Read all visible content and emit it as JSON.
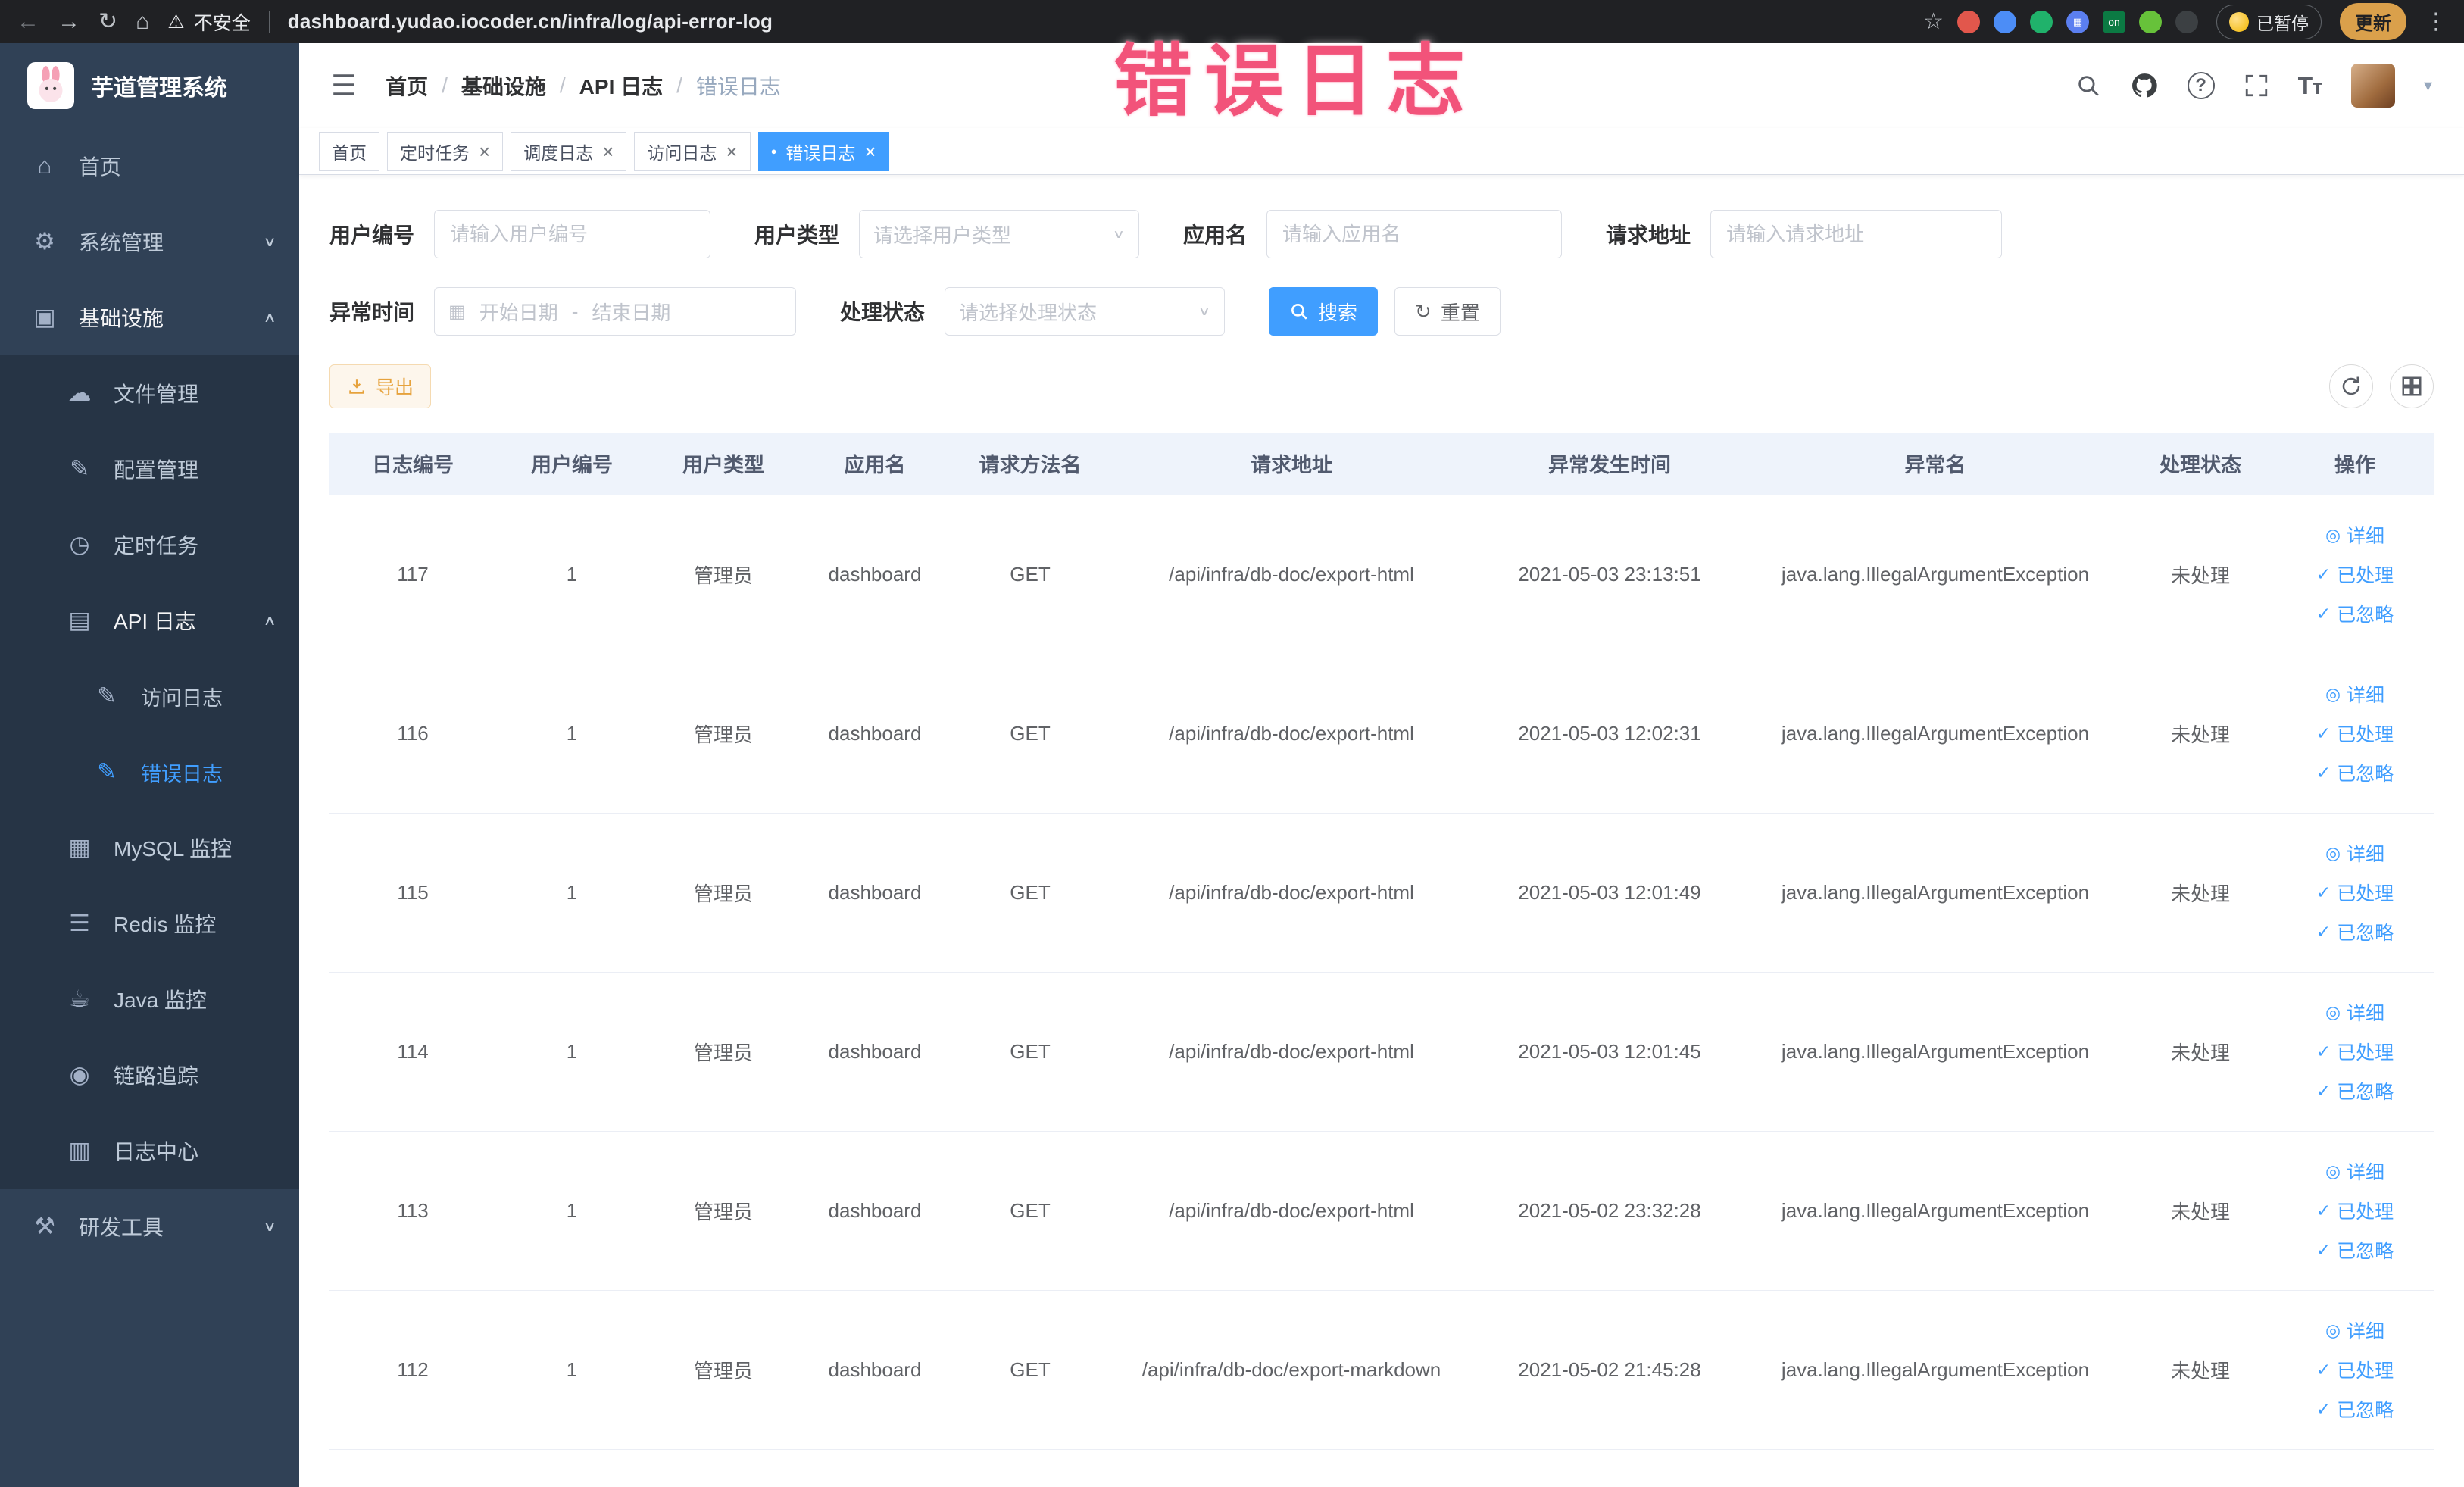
{
  "colors": {
    "primary": "#409eff",
    "warning": "#e6a23c",
    "annotation_pink": "#f2537a",
    "sidebar_bg": "#304156",
    "submenu_bg": "#263445"
  },
  "annotation": {
    "text": "错误日志"
  },
  "browser": {
    "security_label": "不安全",
    "url": "dashboard.yudao.iocoder.cn/infra/log/api-error-log",
    "paused_badge": "已暂停",
    "update_button": "更新"
  },
  "icons": {
    "back": "←",
    "forward": "→",
    "reload": "↻",
    "chrome_home": "⌂",
    "warning": "⚠",
    "star": "☆",
    "menu_dots": "⋮",
    "hamburger": "☰",
    "caret_down": "▾",
    "chevron_down": "∨",
    "chevron_up": "∧",
    "close": "×",
    "dot": "●",
    "check": "✓",
    "eye": "◎",
    "calendar": "▦",
    "separator": "/",
    "home": "⌂",
    "system": "⚙",
    "infra": "▣",
    "file": "☁",
    "config": "✎",
    "job": "◷",
    "api_log": "▤",
    "access_log": "✎",
    "error_log": "✎",
    "mysql": "▦",
    "redis": "☰",
    "java": "☕",
    "tracing": "◉",
    "log_center": "▥",
    "dev_tools": "⚒",
    "grid_glyph": "▦",
    "on_badge": "on"
  },
  "sidebar": {
    "logo_title": "芋道管理系统",
    "menu": {
      "home": "首页",
      "system": "系统管理",
      "infra": "基础设施",
      "dev_tools": "研发工具",
      "infra_children": {
        "file": "文件管理",
        "config": "配置管理",
        "job": "定时任务",
        "api_log": "API 日志",
        "api_access_log": "访问日志",
        "api_error_log": "错误日志",
        "mysql": "MySQL 监控",
        "redis": "Redis 监控",
        "java": "Java 监控",
        "tracing": "链路追踪",
        "log_center": "日志中心"
      }
    }
  },
  "header": {
    "breadcrumb": [
      "首页",
      "基础设施",
      "API 日志",
      "错误日志"
    ]
  },
  "tags": {
    "home": "首页",
    "job": "定时任务",
    "job_log": "调度日志",
    "access_log": "访问日志",
    "error_log": "错误日志"
  },
  "filters": {
    "user_id": {
      "label": "用户编号",
      "placeholder": "请输入用户编号"
    },
    "user_type": {
      "label": "用户类型",
      "placeholder": "请选择用户类型"
    },
    "app_name": {
      "label": "应用名",
      "placeholder": "请输入应用名"
    },
    "request_url": {
      "label": "请求地址",
      "placeholder": "请输入请求地址"
    },
    "exception_time": {
      "label": "异常时间",
      "start_placeholder": "开始日期",
      "separator": "-",
      "end_placeholder": "结束日期"
    },
    "process_status": {
      "label": "处理状态",
      "placeholder": "请选择处理状态"
    },
    "search_button": "搜索",
    "reset_button": "重置"
  },
  "toolbar": {
    "export_label": "导出"
  },
  "table": {
    "columns": [
      "日志编号",
      "用户编号",
      "用户类型",
      "应用名",
      "请求方法名",
      "请求地址",
      "异常发生时间",
      "异常名",
      "处理状态",
      "操作"
    ],
    "actions": {
      "detail": "详细",
      "process": "已处理",
      "ignore": "已忽略"
    },
    "rows": [
      {
        "id": "117",
        "user_id": "1",
        "user_type": "管理员",
        "app": "dashboard",
        "method": "GET",
        "url": "/api/infra/db-doc/export-html",
        "time": "2021-05-03 23:13:51",
        "exception": "java.lang.IllegalArgumentException",
        "status": "未处理"
      },
      {
        "id": "116",
        "user_id": "1",
        "user_type": "管理员",
        "app": "dashboard",
        "method": "GET",
        "url": "/api/infra/db-doc/export-html",
        "time": "2021-05-03 12:02:31",
        "exception": "java.lang.IllegalArgumentException",
        "status": "未处理"
      },
      {
        "id": "115",
        "user_id": "1",
        "user_type": "管理员",
        "app": "dashboard",
        "method": "GET",
        "url": "/api/infra/db-doc/export-html",
        "time": "2021-05-03 12:01:49",
        "exception": "java.lang.IllegalArgumentException",
        "status": "未处理"
      },
      {
        "id": "114",
        "user_id": "1",
        "user_type": "管理员",
        "app": "dashboard",
        "method": "GET",
        "url": "/api/infra/db-doc/export-html",
        "time": "2021-05-03 12:01:45",
        "exception": "java.lang.IllegalArgumentException",
        "status": "未处理"
      },
      {
        "id": "113",
        "user_id": "1",
        "user_type": "管理员",
        "app": "dashboard",
        "method": "GET",
        "url": "/api/infra/db-doc/export-html",
        "time": "2021-05-02 23:32:28",
        "exception": "java.lang.IllegalArgumentException",
        "status": "未处理"
      },
      {
        "id": "112",
        "user_id": "1",
        "user_type": "管理员",
        "app": "dashboard",
        "method": "GET",
        "url": "/api/infra/db-doc/export-markdown",
        "time": "2021-05-02 21:45:28",
        "exception": "java.lang.IllegalArgumentException",
        "status": "未处理"
      }
    ]
  }
}
